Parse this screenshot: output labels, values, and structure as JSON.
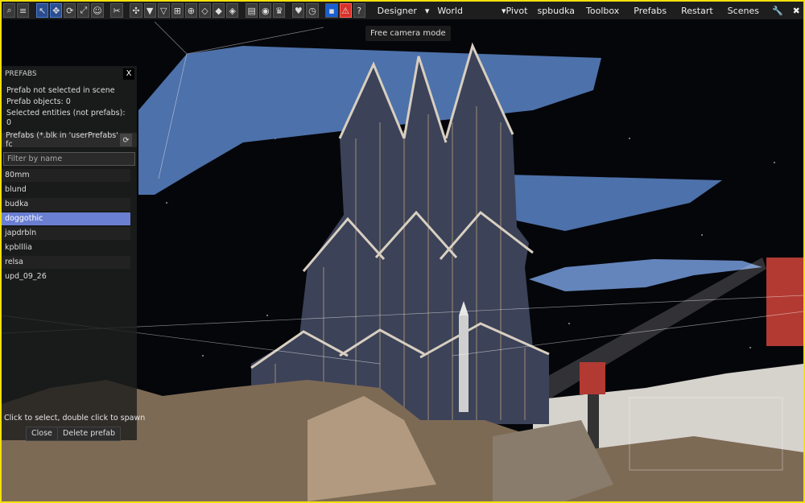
{
  "toolbar": {
    "left_icons": [
      "search-icon",
      "menu-icon"
    ],
    "tool_icons": [
      "select-icon",
      "move-icon",
      "rotate-icon",
      "scale-icon",
      "smiley-icon"
    ],
    "mode_icons": [
      "cut-icon",
      "snap-icon",
      "triangle-down-icon",
      "triangle-outline-icon",
      "grid-icon",
      "target-icon",
      "diamond-outline-icon",
      "diamond-icon",
      "compass-icon"
    ],
    "misc_icons": [
      "document-icon",
      "eye-icon",
      "crown-icon",
      "heart-icon",
      "timer-icon",
      "blue-square-icon",
      "warning-icon",
      "help-icon"
    ],
    "designer": "Designer",
    "designer_arrow": "▾",
    "world": "World",
    "pivot": "▾Pivot",
    "budka": "spbudka",
    "menus": [
      "Toolbox",
      "Prefabs",
      "Restart",
      "Scenes"
    ],
    "wrench": "🔧",
    "close": "✖"
  },
  "tooltip": "Free camera mode",
  "panel": {
    "title": "PREFABS",
    "close": "X",
    "status": "Prefab not selected in scene",
    "objects": "Prefab objects: 0",
    "selected": "Selected entities (not prefabs): 0",
    "path": "Prefabs (*.blk in 'userPrefabs' fc",
    "filter_placeholder": "Filter by name",
    "items": [
      "80mm",
      "blund",
      "budka",
      "doggothic",
      "japdrbln",
      "kpblllia",
      "relsa",
      "upd_09_26"
    ],
    "selected_item": "doggothic",
    "hint": "Click to select, double click to spawn",
    "close_btn": "Close",
    "delete_btn": "Delete prefab"
  },
  "colors": {
    "frame": "#f4e10c",
    "selection": "#6a7fd2",
    "ship": "#5b85c7",
    "warning": "#d8322a"
  }
}
